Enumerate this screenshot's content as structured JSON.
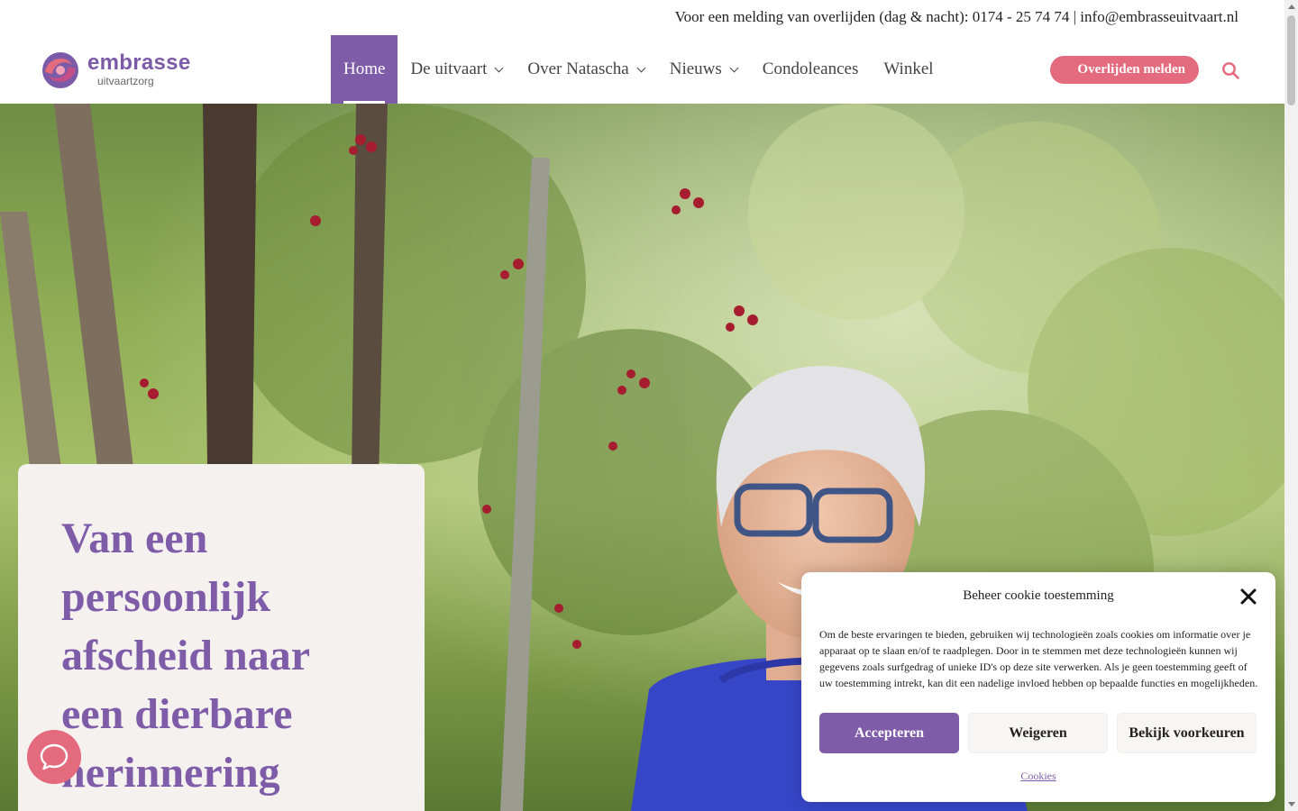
{
  "topbar": {
    "text": "Voor een melding van overlijden (dag & nacht): 0174 - 25 74 74 | info@embrasseuitvaart.nl"
  },
  "logo": {
    "name": "embrasse",
    "subtitle": "uitvaartzorg"
  },
  "nav": {
    "items": [
      {
        "label": "Home",
        "active": true
      },
      {
        "label": "De uitvaart",
        "dropdown": true
      },
      {
        "label": "Over Natascha",
        "dropdown": true
      },
      {
        "label": "Nieuws",
        "dropdown": true
      },
      {
        "label": "Condoleances"
      },
      {
        "label": "Winkel"
      }
    ],
    "report_button": "\u0000 Overlijden melden",
    "search_icon": "search-icon"
  },
  "hero": {
    "title": "Van een persoonlijk afscheid naar een dierbare herinnering"
  },
  "chat": {
    "icon": "chat-bubble-icon"
  },
  "cookie": {
    "title": "Beheer cookie toestemming",
    "body": "Om de beste ervaringen te bieden, gebruiken wij technologieën zoals cookies om informatie over je apparaat op te slaan en/of te raadplegen. Door in te stemmen met deze technologieën kunnen wij gegevens zoals surfgedrag of unieke ID's op deze site verwerken. Als je geen toestemming geeft of uw toestemming intrekt, kan dit een nadelige invloed hebben op bepaalde functies en mogelijkheden.",
    "accept": "Accepteren",
    "deny": "Weigeren",
    "prefs": "Bekijk voorkeuren",
    "link": "Cookies"
  },
  "colors": {
    "brand_purple": "#7f5ca8",
    "accent_pink": "#e46a7d",
    "card_bg": "#f5f1ef"
  }
}
